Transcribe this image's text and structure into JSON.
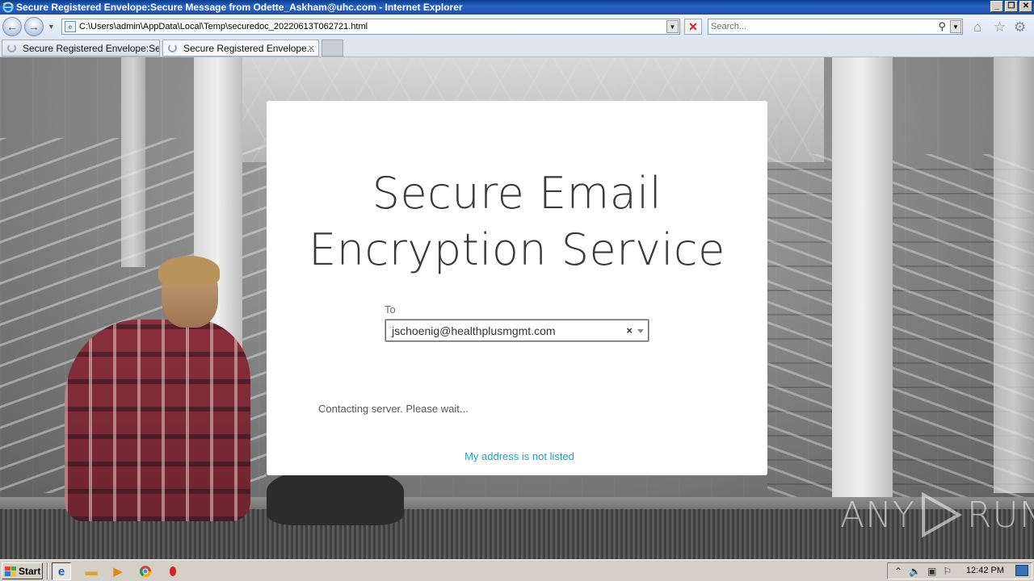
{
  "window": {
    "title": "Secure Registered Envelope:Secure Message from Odette_Askham@uhc.com - Internet Explorer",
    "min": "_",
    "max": "❐",
    "close": "✕"
  },
  "navbar": {
    "url": "C:\\Users\\admin\\AppData\\Local\\Temp\\securedoc_20220613T062721.html",
    "search_placeholder": "Search..."
  },
  "tabs": [
    {
      "label": "Secure Registered Envelope:Se..."
    },
    {
      "label": "Secure Registered Envelope...",
      "close": "×"
    }
  ],
  "card": {
    "title_line1": "Secure Email",
    "title_line2": "Encryption Service",
    "to_label": "To",
    "recipient": "jschoenig@healthplusmgmt.com",
    "clear_symbol": "×",
    "status": "Contacting server. Please wait...",
    "link": "My address is not listed"
  },
  "watermark": {
    "left": "ANY",
    "right": "RUN"
  },
  "taskbar": {
    "start_label": "Start",
    "clock": "12:42 PM"
  },
  "icons": [
    "ie-icon",
    "back-arrow-icon",
    "forward-arrow-icon",
    "stop-icon",
    "search-icon",
    "home-icon",
    "star-icon",
    "gear-icon",
    "folder-icon",
    "media-player-icon",
    "chrome-icon",
    "opera-icon"
  ],
  "colors": {
    "link": "#1ba0c8",
    "titlebar": "#1d4fae"
  }
}
